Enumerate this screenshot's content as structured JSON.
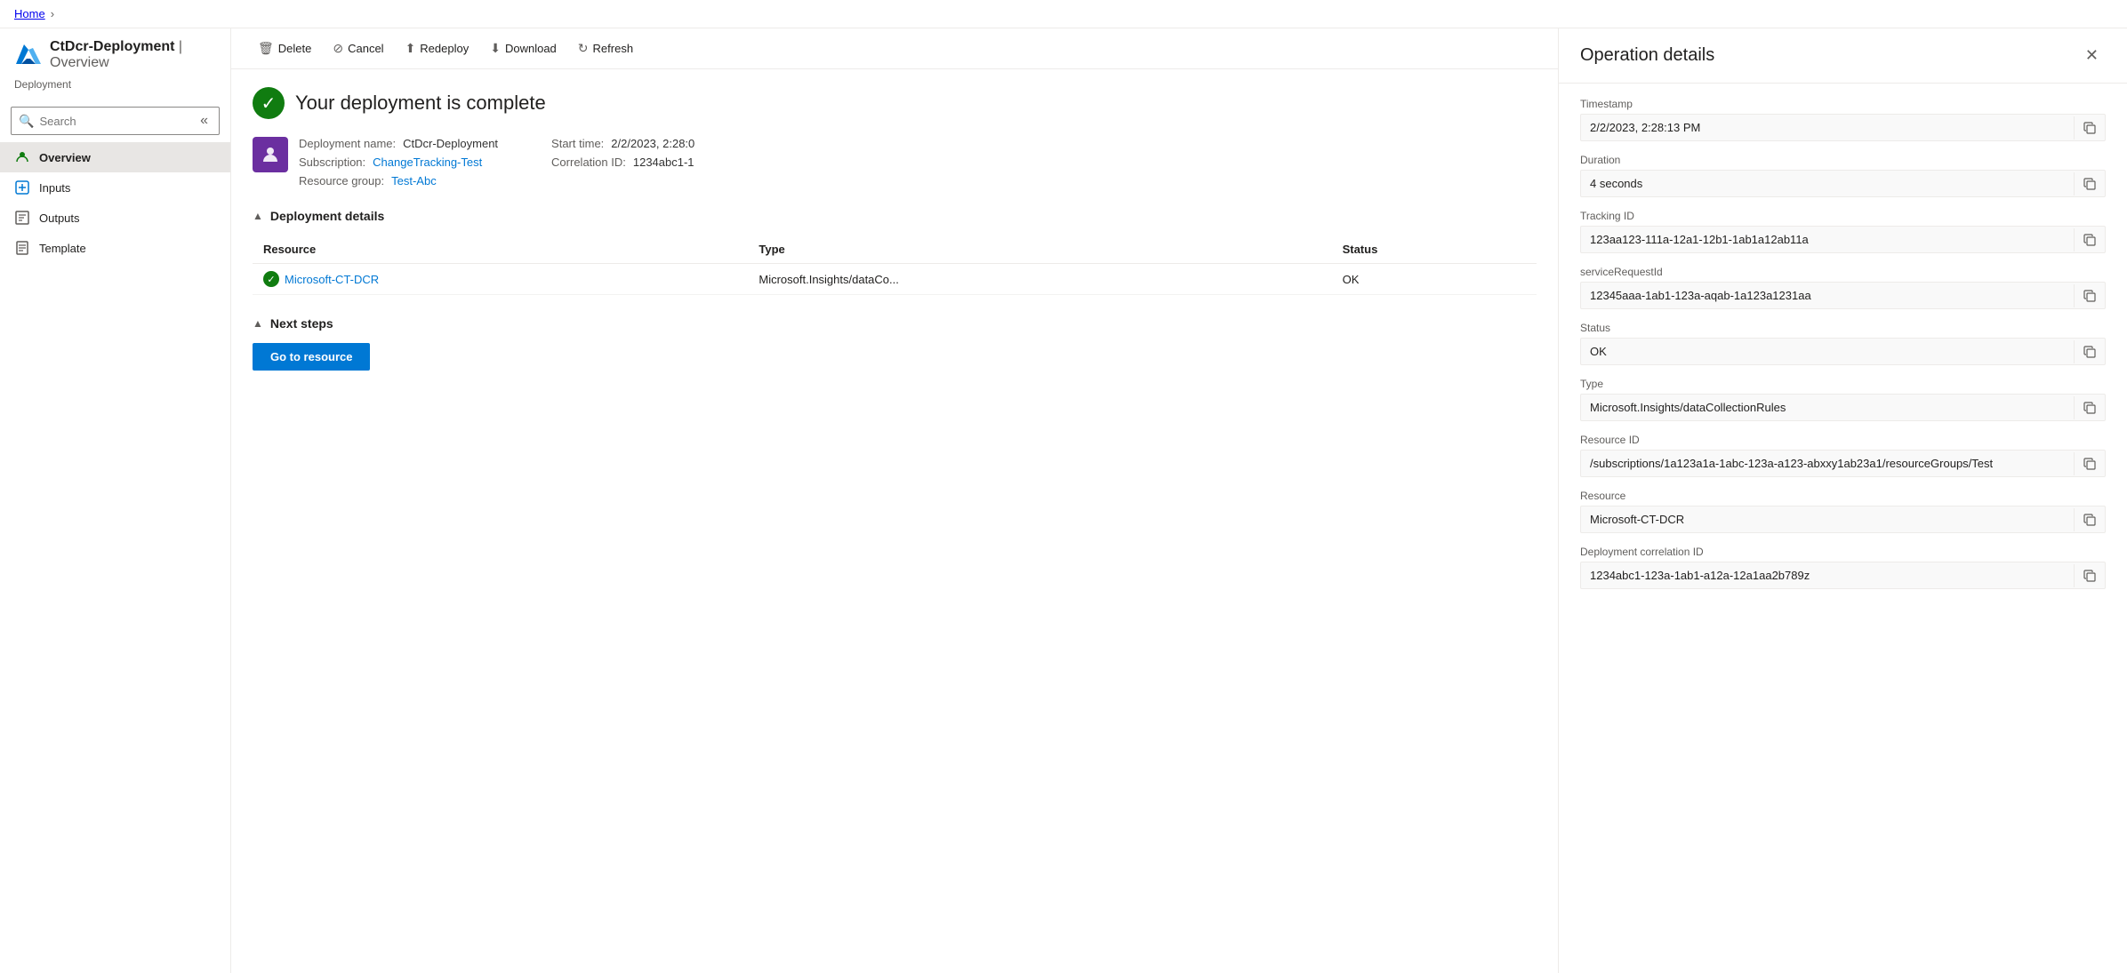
{
  "breadcrumb": {
    "home": "Home",
    "separator": "›"
  },
  "sidebar": {
    "title": "CtDcr-Deployment",
    "subtitle": "Deployment",
    "search_placeholder": "Search",
    "nav_items": [
      {
        "id": "overview",
        "label": "Overview",
        "icon": "👤",
        "active": true
      },
      {
        "id": "inputs",
        "label": "Inputs",
        "icon": "📥",
        "active": false
      },
      {
        "id": "outputs",
        "label": "Outputs",
        "icon": "📤",
        "active": false
      },
      {
        "id": "template",
        "label": "Template",
        "icon": "📄",
        "active": false
      }
    ]
  },
  "toolbar": {
    "delete_label": "Delete",
    "cancel_label": "Cancel",
    "redeploy_label": "Redeploy",
    "download_label": "Download",
    "refresh_label": "Refresh"
  },
  "main": {
    "deployment_status": "Your deployment is complete",
    "deployment_name_label": "Deployment name:",
    "deployment_name": "CtDcr-Deployment",
    "subscription_label": "Subscription:",
    "subscription": "ChangeTracking-Test",
    "resource_group_label": "Resource group:",
    "resource_group": "Test-Abc",
    "start_time_label": "Start time:",
    "start_time": "2/2/2023, 2:28:0",
    "correlation_label": "Correlation ID:",
    "correlation_id": "1234abc1-1",
    "deployment_details_label": "Deployment details",
    "next_steps_label": "Next steps",
    "go_to_resource_label": "Go to resource",
    "table": {
      "columns": [
        "Resource",
        "Type",
        "Status"
      ],
      "rows": [
        {
          "resource": "Microsoft-CT-DCR",
          "type": "Microsoft.Insights/dataCo...",
          "status": "OK"
        }
      ]
    }
  },
  "operation_details": {
    "title": "Operation details",
    "fields": [
      {
        "label": "Timestamp",
        "value": "2/2/2023, 2:28:13 PM"
      },
      {
        "label": "Duration",
        "value": "4 seconds"
      },
      {
        "label": "Tracking ID",
        "value": "123aa123-111a-12a1-12b1-1ab1a12ab11a"
      },
      {
        "label": "serviceRequestId",
        "value": "12345aaa-1ab1-123a-aqab-1a123a1231aa"
      },
      {
        "label": "Status",
        "value": "OK"
      },
      {
        "label": "Type",
        "value": "Microsoft.Insights/dataCollectionRules"
      },
      {
        "label": "Resource ID",
        "value": "/subscriptions/1a123a1a-1abc-123a-a123-abxxy1ab23a1/resourceGroups/Test"
      },
      {
        "label": "Resource",
        "value": "Microsoft-CT-DCR"
      },
      {
        "label": "Deployment correlation ID",
        "value": "1234abc1-123a-1ab1-a12a-12a1aa2b789z"
      }
    ]
  }
}
